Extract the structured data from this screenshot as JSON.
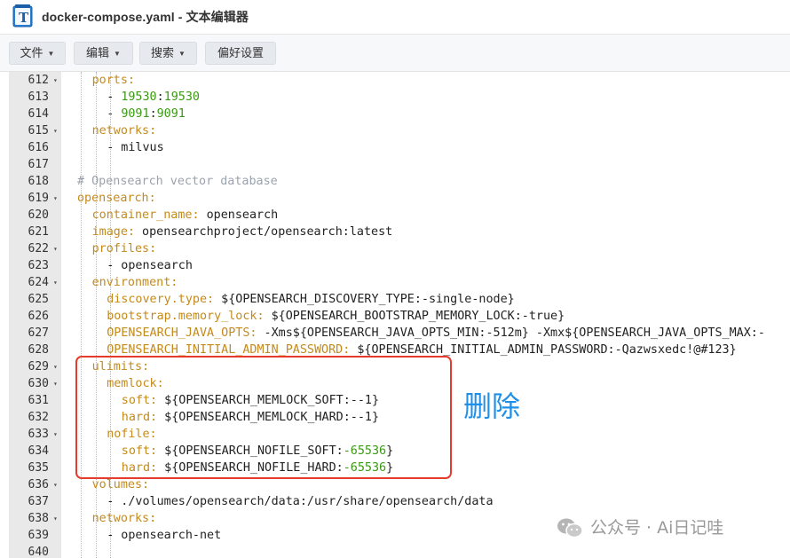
{
  "window": {
    "title": "docker-compose.yaml - 文本编辑器"
  },
  "toolbar": {
    "buttons": [
      {
        "label": "文件",
        "has_caret": true
      },
      {
        "label": "编辑",
        "has_caret": true
      },
      {
        "label": "搜索",
        "has_caret": true
      },
      {
        "label": "偏好设置",
        "has_caret": false
      }
    ]
  },
  "editor": {
    "lines": [
      {
        "n": "612",
        "fold": true,
        "indent": 2,
        "segs": [
          [
            "k",
            "ports:"
          ]
        ]
      },
      {
        "n": "613",
        "fold": false,
        "indent": 3,
        "segs": [
          [
            "s",
            "- "
          ],
          [
            "n",
            "19530"
          ],
          [
            "s",
            ":"
          ],
          [
            "n",
            "19530"
          ]
        ]
      },
      {
        "n": "614",
        "fold": false,
        "indent": 3,
        "segs": [
          [
            "s",
            "- "
          ],
          [
            "n",
            "9091"
          ],
          [
            "s",
            ":"
          ],
          [
            "n",
            "9091"
          ]
        ]
      },
      {
        "n": "615",
        "fold": true,
        "indent": 2,
        "segs": [
          [
            "k",
            "networks:"
          ]
        ]
      },
      {
        "n": "616",
        "fold": false,
        "indent": 3,
        "segs": [
          [
            "s",
            "- milvus"
          ]
        ]
      },
      {
        "n": "617",
        "fold": false,
        "indent": 0,
        "segs": []
      },
      {
        "n": "618",
        "fold": false,
        "indent": 1,
        "segs": [
          [
            "c",
            "# Opensearch vector database"
          ]
        ]
      },
      {
        "n": "619",
        "fold": true,
        "indent": 1,
        "segs": [
          [
            "k",
            "opensearch:"
          ]
        ]
      },
      {
        "n": "620",
        "fold": false,
        "indent": 2,
        "segs": [
          [
            "k",
            "container_name:"
          ],
          [
            "s",
            " opensearch"
          ]
        ]
      },
      {
        "n": "621",
        "fold": false,
        "indent": 2,
        "segs": [
          [
            "k",
            "image:"
          ],
          [
            "s",
            " opensearchproject/opensearch:latest"
          ]
        ]
      },
      {
        "n": "622",
        "fold": true,
        "indent": 2,
        "segs": [
          [
            "k",
            "profiles:"
          ]
        ]
      },
      {
        "n": "623",
        "fold": false,
        "indent": 3,
        "segs": [
          [
            "s",
            "- opensearch"
          ]
        ]
      },
      {
        "n": "624",
        "fold": true,
        "indent": 2,
        "segs": [
          [
            "k",
            "environment:"
          ]
        ]
      },
      {
        "n": "625",
        "fold": false,
        "indent": 3,
        "segs": [
          [
            "k",
            "discovery.type:"
          ],
          [
            "s",
            " ${OPENSEARCH_DISCOVERY_TYPE:-single-node}"
          ]
        ]
      },
      {
        "n": "626",
        "fold": false,
        "indent": 3,
        "segs": [
          [
            "k",
            "bootstrap.memory_lock:"
          ],
          [
            "s",
            " ${OPENSEARCH_BOOTSTRAP_MEMORY_LOCK:-true}"
          ]
        ]
      },
      {
        "n": "627",
        "fold": false,
        "indent": 3,
        "segs": [
          [
            "k",
            "OPENSEARCH_JAVA_OPTS:"
          ],
          [
            "s",
            " -Xms${OPENSEARCH_JAVA_OPTS_MIN:-512m} -Xmx${OPENSEARCH_JAVA_OPTS_MAX:-"
          ]
        ]
      },
      {
        "n": "628",
        "fold": false,
        "indent": 3,
        "segs": [
          [
            "k",
            "OPENSEARCH_INITIAL_ADMIN_PASSWORD:"
          ],
          [
            "s",
            " ${OPENSEARCH_INITIAL_ADMIN_PASSWORD:-Qazwsxedc!@#123}"
          ]
        ]
      },
      {
        "n": "629",
        "fold": true,
        "indent": 2,
        "segs": [
          [
            "k",
            "ulimits:"
          ]
        ]
      },
      {
        "n": "630",
        "fold": true,
        "indent": 3,
        "segs": [
          [
            "k",
            "memlock:"
          ]
        ]
      },
      {
        "n": "631",
        "fold": false,
        "indent": 4,
        "segs": [
          [
            "k",
            "soft:"
          ],
          [
            "s",
            " ${OPENSEARCH_MEMLOCK_SOFT:--1}"
          ]
        ]
      },
      {
        "n": "632",
        "fold": false,
        "indent": 4,
        "segs": [
          [
            "k",
            "hard:"
          ],
          [
            "s",
            " ${OPENSEARCH_MEMLOCK_HARD:--1}"
          ]
        ]
      },
      {
        "n": "633",
        "fold": true,
        "indent": 3,
        "segs": [
          [
            "k",
            "nofile:"
          ]
        ]
      },
      {
        "n": "634",
        "fold": false,
        "indent": 4,
        "segs": [
          [
            "k",
            "soft:"
          ],
          [
            "s",
            " ${OPENSEARCH_NOFILE_SOFT:"
          ],
          [
            "n",
            "-65536"
          ],
          [
            "s",
            "}"
          ]
        ]
      },
      {
        "n": "635",
        "fold": false,
        "indent": 4,
        "segs": [
          [
            "k",
            "hard:"
          ],
          [
            "s",
            " ${OPENSEARCH_NOFILE_HARD:"
          ],
          [
            "n",
            "-65536"
          ],
          [
            "s",
            "}"
          ]
        ]
      },
      {
        "n": "636",
        "fold": true,
        "indent": 2,
        "segs": [
          [
            "k",
            "volumes:"
          ]
        ]
      },
      {
        "n": "637",
        "fold": false,
        "indent": 3,
        "segs": [
          [
            "s",
            "- ./volumes/opensearch/data:/usr/share/opensearch/data"
          ]
        ]
      },
      {
        "n": "638",
        "fold": true,
        "indent": 2,
        "segs": [
          [
            "k",
            "networks:"
          ]
        ]
      },
      {
        "n": "639",
        "fold": false,
        "indent": 3,
        "segs": [
          [
            "s",
            "- opensearch-net"
          ]
        ]
      },
      {
        "n": "640",
        "fold": false,
        "indent": 0,
        "segs": []
      }
    ]
  },
  "annotation": {
    "text": "删除",
    "box_color": "#e43b2c",
    "text_color": "#1f8fe8"
  },
  "watermark": {
    "text": "公众号 · Ai日记哇",
    "icon": "wechat-icon"
  },
  "colors": {
    "key": "#c48a1c",
    "number": "#3a9a13",
    "comment": "#9aa3ad",
    "gutter": "#e9e9e9"
  }
}
